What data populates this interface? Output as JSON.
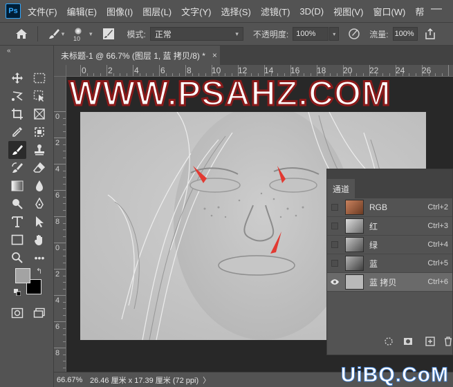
{
  "app": {
    "logo": "Ps"
  },
  "menu": [
    "文件(F)",
    "编辑(E)",
    "图像(I)",
    "图层(L)",
    "文字(Y)",
    "选择(S)",
    "滤镜(T)",
    "3D(D)",
    "视图(V)",
    "窗口(W)",
    "帮"
  ],
  "options": {
    "brush_size": "10",
    "mode_label": "模式:",
    "mode_value": "正常",
    "opacity_label": "不透明度:",
    "opacity_value": "100%",
    "flow_label": "流量:",
    "flow_value": "100%"
  },
  "document": {
    "tab_title": "未标题-1 @ 66.7% (图层 1, 蓝 拷贝/8) *",
    "close": "×"
  },
  "rulers": {
    "h": [
      "0",
      "2",
      "4",
      "6",
      "8",
      "10",
      "12",
      "14",
      "16",
      "18",
      "20",
      "22",
      "24",
      "26"
    ],
    "v": [
      "0",
      "2",
      "4",
      "6",
      "8",
      "0",
      "2",
      "4",
      "6",
      "8"
    ]
  },
  "banner": "WWW.PSAHZ.COM",
  "channels": {
    "tab": "通道",
    "rows": [
      {
        "name": "RGB",
        "shortcut": "Ctrl+2",
        "thumb": "color"
      },
      {
        "name": "红",
        "shortcut": "Ctrl+3",
        "thumb": "gray"
      },
      {
        "name": "绿",
        "shortcut": "Ctrl+4",
        "thumb": "gray"
      },
      {
        "name": "蓝",
        "shortcut": "Ctrl+5",
        "thumb": "gray"
      },
      {
        "name": "蓝 拷贝",
        "shortcut": "Ctrl+6",
        "thumb": "emboss",
        "selected": true,
        "visible": true
      }
    ]
  },
  "status": {
    "zoom": "66.67%",
    "doc_size": "26.46 厘米 x 17.39 厘米 (72 ppi)",
    "caret": "〉"
  },
  "watermark": "UiBQ.CoM",
  "colors": {
    "foreground": "#a3a3a3",
    "background": "#000000",
    "arrow": "#e23a32",
    "banner_stroke": "#8b1a1a"
  }
}
